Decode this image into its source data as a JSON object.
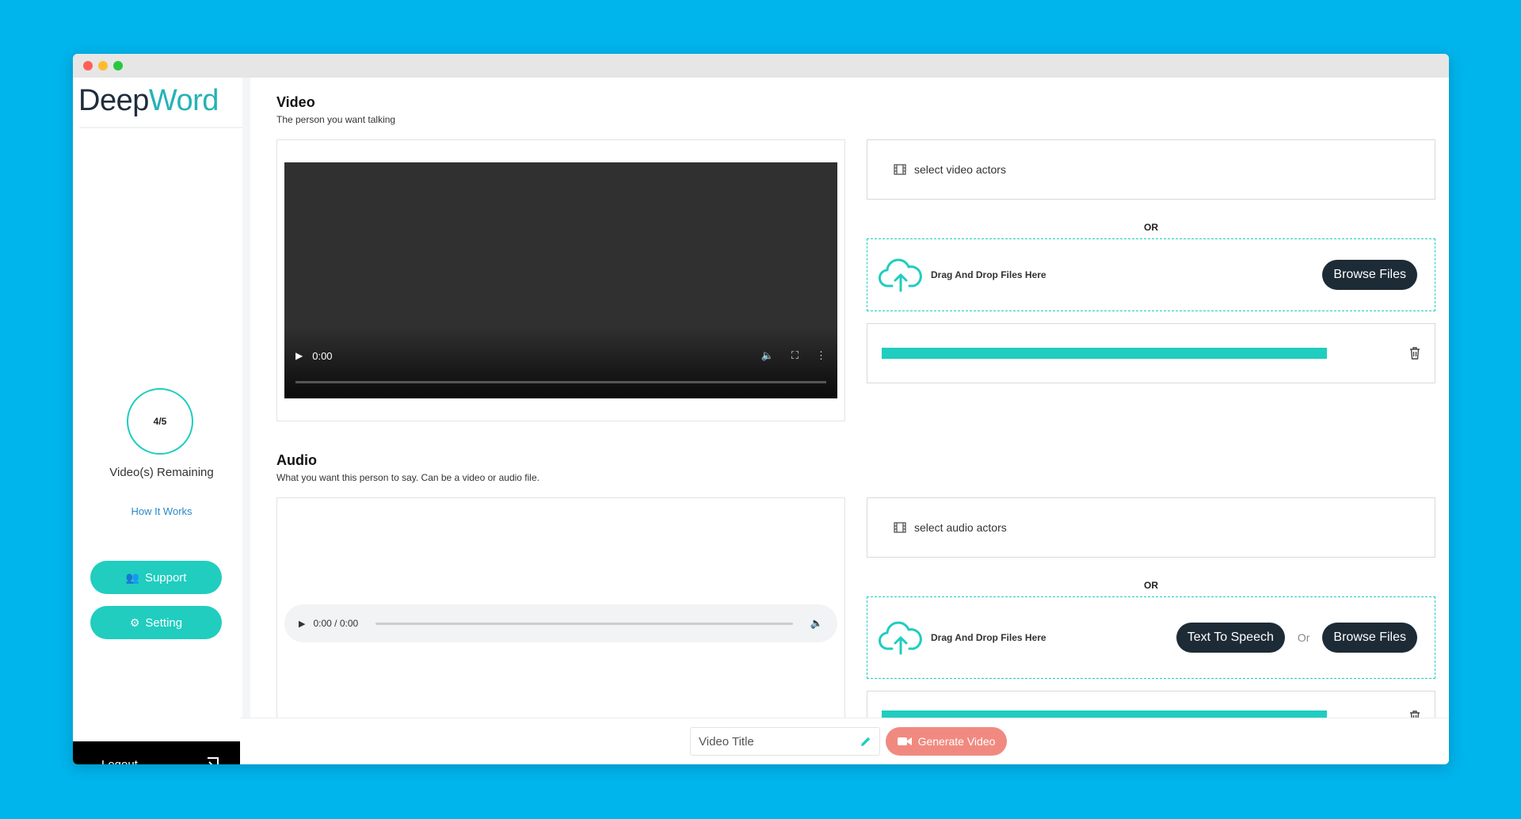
{
  "brand": {
    "part1": "Deep",
    "part2": "Word"
  },
  "sidebar": {
    "counter": "4/5",
    "remaining_label": "Video(s) Remaining",
    "how_it_works": "How It Works",
    "support_label": "Support",
    "setting_label": "Setting",
    "logout_label": "Logout"
  },
  "video": {
    "title": "Video",
    "subtitle": "The person you want talking",
    "player_time": "0:00",
    "select_actors": "select video actors",
    "or": "OR",
    "drop_label": "Drag And Drop Files Here",
    "browse": "Browse Files",
    "upload_progress": 1.0
  },
  "audio": {
    "title": "Audio",
    "subtitle": "What you want this person to say. Can be a video or audio file.",
    "player_time": "0:00 / 0:00",
    "select_actors": "select audio actors",
    "or": "OR",
    "drop_label": "Drag And Drop Files Here",
    "tts": "Text To Speech",
    "or_small": "Or",
    "browse": "Browse Files",
    "upload_progress": 1.0
  },
  "footer": {
    "title_placeholder": "Video Title",
    "generate": "Generate Video"
  },
  "colors": {
    "accent": "#20cdbf",
    "dark": "#1d2b36",
    "generate": "#f08a80",
    "background": "#00b4ec"
  }
}
